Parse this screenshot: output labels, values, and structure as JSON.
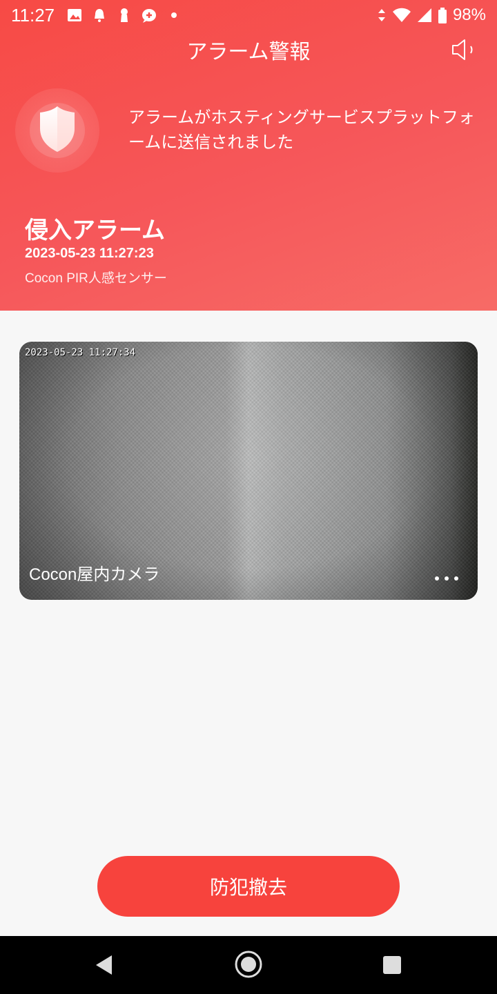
{
  "status_bar": {
    "time": "11:27",
    "battery": "98%",
    "left_icons": [
      "image-icon",
      "bell-icon",
      "keyhole-icon",
      "chat-plus-icon",
      "dot-icon"
    ],
    "right_icons": [
      "data-arrows-icon",
      "wifi-icon",
      "signal-icon",
      "battery-icon"
    ]
  },
  "header": {
    "title": "アラーム警報",
    "speaker_icon": "speaker-icon",
    "shield_icon": "shield-icon",
    "message": "アラームがホスティングサービスプラットフォームに送信されました",
    "alarm_type": "侵入アラーム",
    "alarm_time": "2023-05-23 11:27:23",
    "device_name": "Cocon PIR人感センサー"
  },
  "camera": {
    "timestamp": "2023-05-23 11:27:34",
    "name": "Cocon屋内カメラ",
    "more_icon": "more-dots-icon"
  },
  "actions": {
    "disarm_label": "防犯撤去"
  },
  "nav_bar": {
    "back_icon": "back-icon",
    "home_icon": "home-icon",
    "recents_icon": "recents-icon"
  },
  "colors": {
    "accent": "#f7433d",
    "header": "#f6575a",
    "background": "#f7f7f7"
  }
}
